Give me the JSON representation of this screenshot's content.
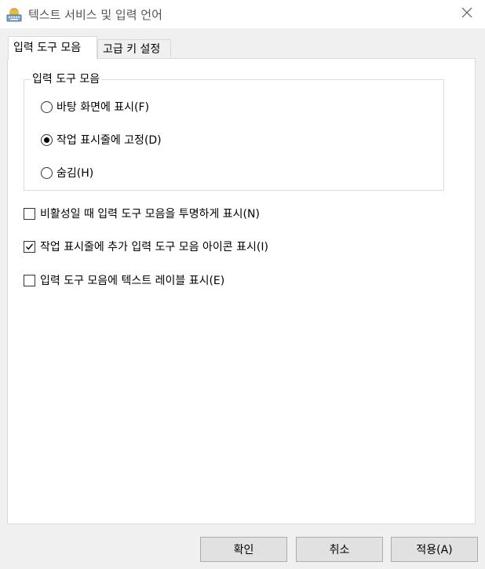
{
  "window": {
    "title": "텍스트 서비스 및 입력 언어",
    "icon": "keyboard-globe-icon",
    "close_icon": "close-icon"
  },
  "tabs": [
    {
      "label": "입력 도구 모음",
      "active": true
    },
    {
      "label": "고급 키 설정",
      "active": false
    }
  ],
  "language_bar_group": {
    "legend": "입력 도구 모음",
    "options": [
      {
        "label": "바탕 화면에 표시(F)",
        "checked": false
      },
      {
        "label": "작업 표시줄에 고정(D)",
        "checked": true
      },
      {
        "label": "숨김(H)",
        "checked": false
      }
    ]
  },
  "checkboxes": [
    {
      "label": "비활성일 때 입력 도구 모음을 투명하게 표시(N)",
      "checked": false
    },
    {
      "label": "작업 표시줄에 추가 입력 도구 모음 아이콘 표시(I)",
      "checked": true
    },
    {
      "label": "입력 도구 모음에 텍스트 레이블 표시(E)",
      "checked": false
    }
  ],
  "buttons": {
    "ok": "확인",
    "cancel": "취소",
    "apply": "적용(A)"
  }
}
